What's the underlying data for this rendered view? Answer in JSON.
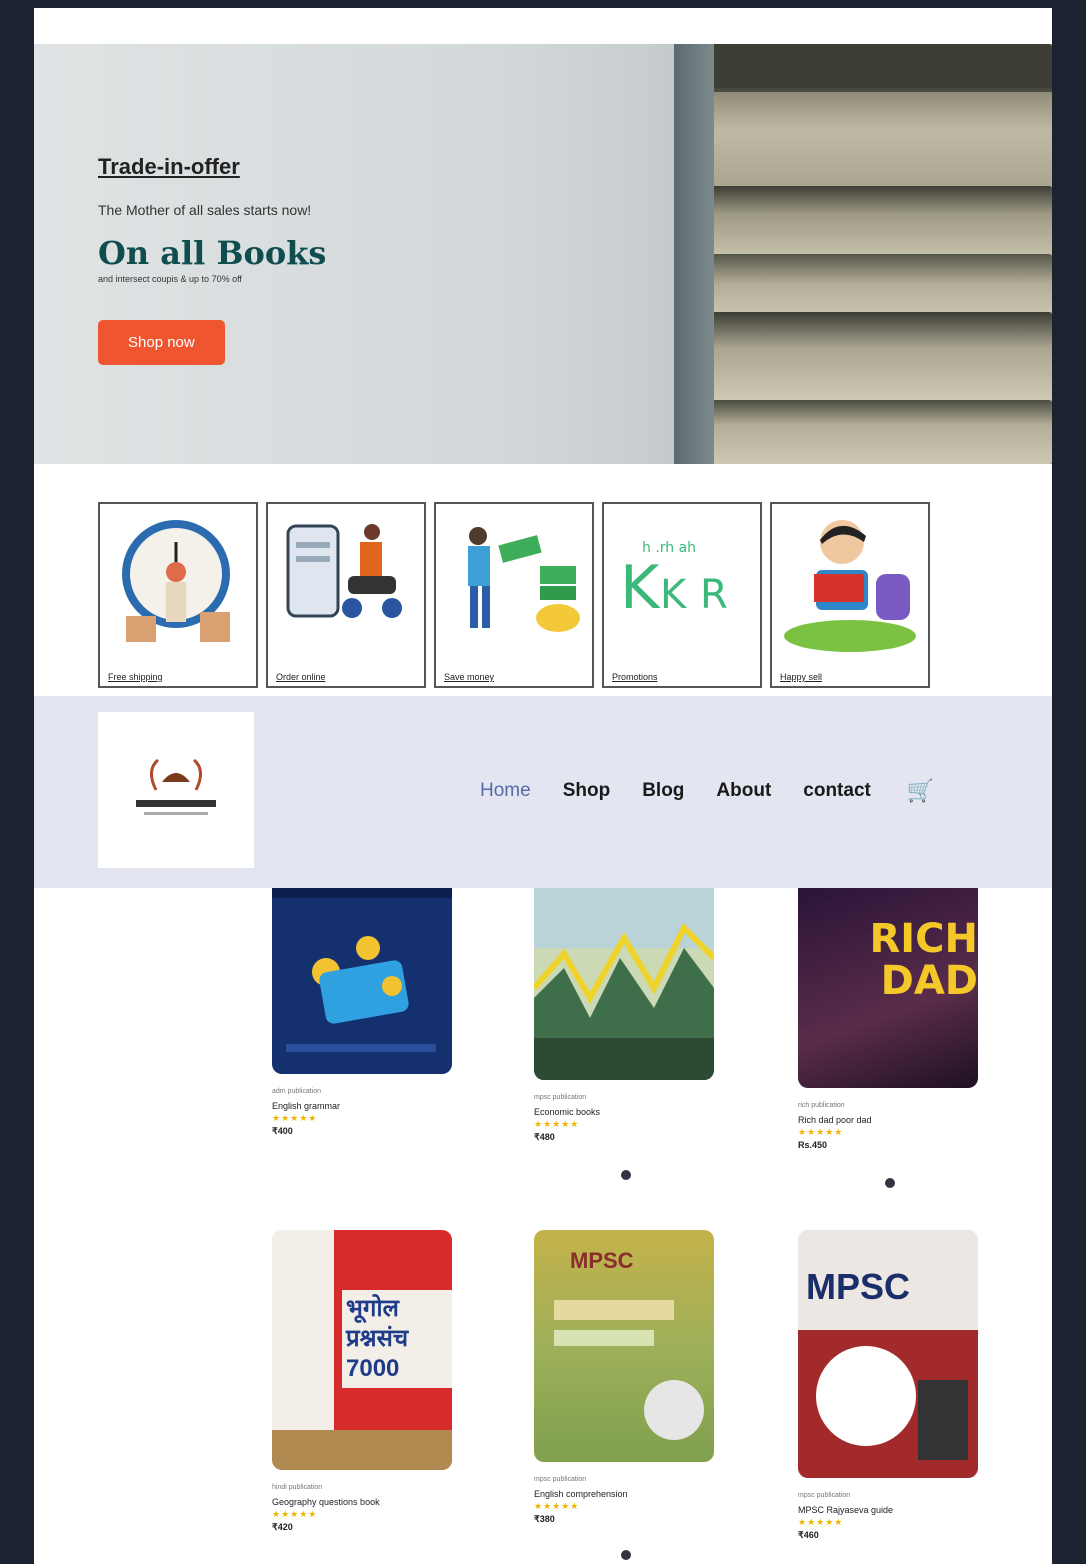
{
  "hero": {
    "kicker": "Trade-in-offer",
    "subtitle": "The Mother of all sales starts now!",
    "title": "On all Books",
    "small": "and intersect coupis & up to 70% off",
    "button": "Shop now"
  },
  "features": [
    {
      "label": "Free shipping",
      "icon": "clock-delivery-icon"
    },
    {
      "label": "Order online",
      "icon": "phone-delivery-icon"
    },
    {
      "label": "Save money",
      "icon": "money-icon"
    },
    {
      "label": "Promotions",
      "icon": "letters-icon"
    },
    {
      "label": "Happy sell",
      "icon": "child-reading-icon"
    }
  ],
  "nav": {
    "items": [
      "Home",
      "Shop",
      "Blog",
      "About",
      "contact"
    ],
    "active": "Home",
    "cart_icon": "cart-icon"
  },
  "products": [
    {
      "brand": "adm publication",
      "name": "English grammar",
      "stars": "★★★★★",
      "price": "₹400",
      "cover_text": ""
    },
    {
      "brand": "mpsc publication",
      "name": "Economic books",
      "stars": "★★★★★",
      "price": "₹480",
      "cover_text": ""
    },
    {
      "brand": "rich publication",
      "name": "Rich dad poor dad",
      "stars": "★★★★★",
      "price": "Rs.450",
      "cover_text": "RICH DAD"
    },
    {
      "brand": "hindi publication",
      "name": "Geography questions book",
      "stars": "★★★★★",
      "price": "₹420",
      "cover_text": "भूगोल प्रश्नसंच 7000"
    },
    {
      "brand": "mpsc publication",
      "name": "English comprehension",
      "stars": "★★★★★",
      "price": "₹380",
      "cover_text": "MPSC"
    },
    {
      "brand": "mpsc publication",
      "name": "MPSC Rajyaseva guide",
      "stars": "★★★★★",
      "price": "₹460",
      "cover_text": "MPSC"
    }
  ],
  "colors": {
    "accent": "#ef5630",
    "nav_bg": "#e3e6f1",
    "title": "#0f4d4f"
  }
}
